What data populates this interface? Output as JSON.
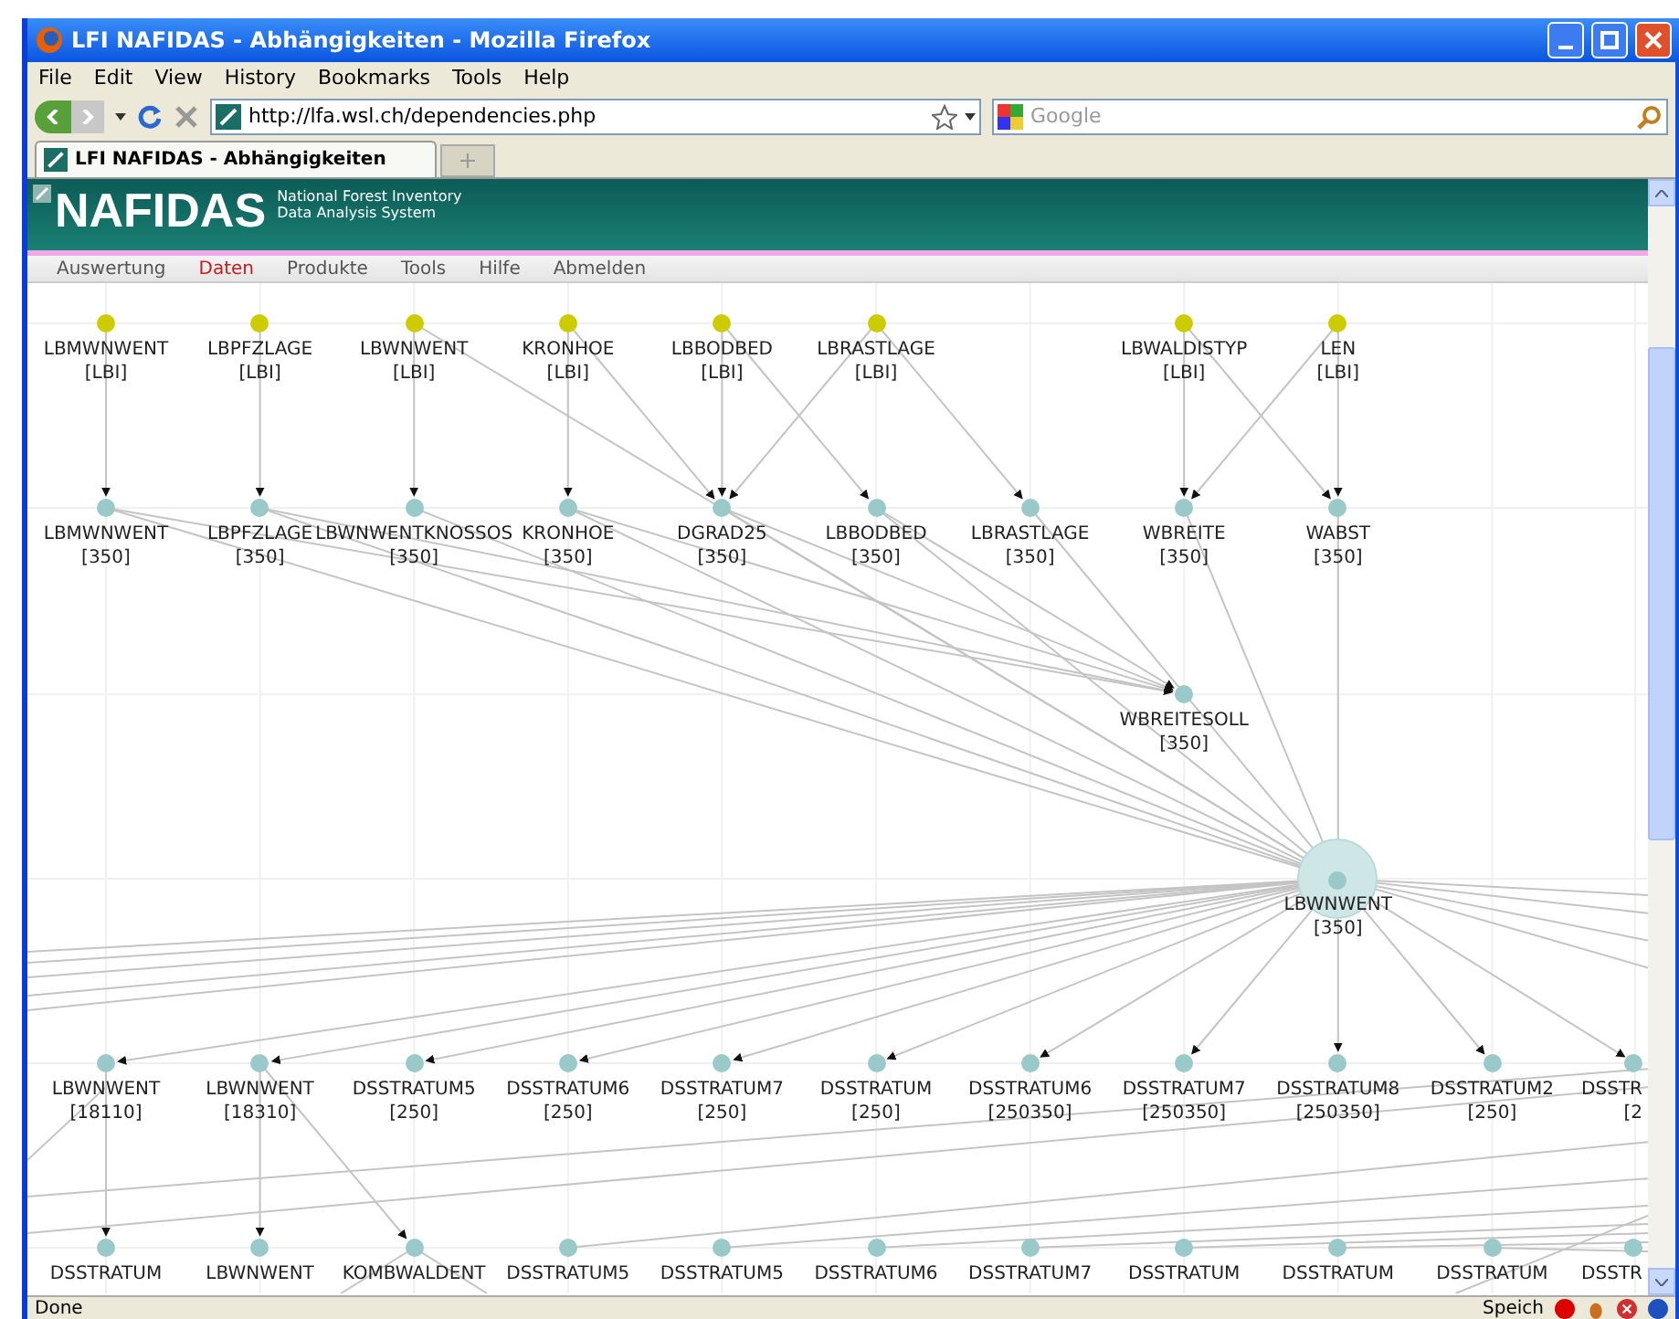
{
  "window": {
    "title": "LFI NAFIDAS - Abhängigkeiten - Mozilla Firefox"
  },
  "menu_bar": [
    "File",
    "Edit",
    "View",
    "History",
    "Bookmarks",
    "Tools",
    "Help"
  ],
  "toolbar": {
    "url": "http://lfa.wsl.ch/dependencies.php",
    "search_placeholder": "Google"
  },
  "tabs": [
    {
      "label": "LFI NAFIDAS - Abhängigkeiten",
      "selected": true
    }
  ],
  "site": {
    "logo": "NAFIDAS",
    "subtitle": [
      "National Forest Inventory",
      "Data Analysis System"
    ],
    "nav": [
      {
        "label": "Auswertung",
        "selected": false
      },
      {
        "label": "Daten",
        "selected": true
      },
      {
        "label": "Produkte",
        "selected": false
      },
      {
        "label": "Tools",
        "selected": false
      },
      {
        "label": "Hilfe",
        "selected": false
      },
      {
        "label": "Abmelden",
        "selected": false
      }
    ]
  },
  "graph": {
    "rows": [
      [
        {
          "name": "LBMWNWENT",
          "tag": "[LBI]",
          "kind": "input"
        },
        {
          "name": "LBPFZLAGE",
          "tag": "[LBI]",
          "kind": "input"
        },
        {
          "name": "LBWNWENT",
          "tag": "[LBI]",
          "kind": "input"
        },
        {
          "name": "KRONHOE",
          "tag": "[LBI]",
          "kind": "input"
        },
        {
          "name": "LBBODBED",
          "tag": "[LBI]",
          "kind": "input"
        },
        {
          "name": "LBRASTLAGE",
          "tag": "[LBI]",
          "kind": "input"
        },
        "",
        {
          "name": "LBWALDISTYP",
          "tag": "[LBI]",
          "kind": "input"
        },
        {
          "name": "LEN",
          "tag": "[LBI]",
          "kind": "input"
        }
      ],
      [
        {
          "name": "LBMWNWENT",
          "tag": "[350]",
          "kind": "derived"
        },
        {
          "name": "LBPFZLAGE",
          "tag": "[350]",
          "kind": "derived"
        },
        {
          "name": "LBWNWENTKNOSSOS",
          "tag": "[350]",
          "kind": "derived"
        },
        {
          "name": "KRONHOE",
          "tag": "[350]",
          "kind": "derived"
        },
        {
          "name": "DGRAD25",
          "tag": "[350]",
          "kind": "derived"
        },
        {
          "name": "LBBODBED",
          "tag": "[350]",
          "kind": "derived"
        },
        {
          "name": "LBRASTLAGE",
          "tag": "[350]",
          "kind": "derived"
        },
        {
          "name": "WBREITE",
          "tag": "[350]",
          "kind": "derived"
        },
        {
          "name": "WABST",
          "tag": "[350]",
          "kind": "derived"
        }
      ],
      [
        "",
        "",
        "",
        "",
        "",
        "",
        "",
        {
          "name": "WBREITESOLL",
          "tag": "[350]",
          "kind": "derived"
        }
      ],
      [
        "",
        "",
        "",
        "",
        "",
        "",
        "",
        "",
        {
          "name": "LBWNWENT",
          "tag": "[350]",
          "kind": "focus"
        }
      ],
      [
        {
          "name": "LBWNWENT",
          "tag": "[18110]",
          "kind": "derived"
        },
        {
          "name": "LBWNWENT",
          "tag": "[18310]",
          "kind": "derived"
        },
        {
          "name": "DSSTRATUM5",
          "tag": "[250]",
          "kind": "derived"
        },
        {
          "name": "DSSTRATUM6",
          "tag": "[250]",
          "kind": "derived"
        },
        {
          "name": "DSSTRATUM7",
          "tag": "[250]",
          "kind": "derived"
        },
        {
          "name": "DSSTRATUM",
          "tag": "[250]",
          "kind": "derived"
        },
        {
          "name": "DSSTRATUM6",
          "tag": "[250350]",
          "kind": "derived"
        },
        {
          "name": "DSSTRATUM7",
          "tag": "[250350]",
          "kind": "derived"
        },
        {
          "name": "DSSTRATUM8",
          "tag": "[250350]",
          "kind": "derived"
        },
        {
          "name": "DSSTRATUM2",
          "tag": "[250]",
          "kind": "derived"
        },
        {
          "name": "DSSTR",
          "tag": "[2",
          "kind": "derived"
        }
      ],
      [
        {
          "name": "DSSTRATUM",
          "kind": "derived"
        },
        {
          "name": "LBWNWENT",
          "kind": "derived"
        },
        {
          "name": "KOMBWALDENT",
          "kind": "derived"
        },
        {
          "name": "DSSTRATUM5",
          "kind": "derived"
        },
        {
          "name": "DSSTRATUM5",
          "kind": "derived"
        },
        {
          "name": "DSSTRATUM6",
          "kind": "derived"
        },
        {
          "name": "DSSTRATUM7",
          "kind": "derived"
        },
        {
          "name": "DSSTRATUM",
          "kind": "derived"
        },
        {
          "name": "DSSTRATUM",
          "kind": "derived"
        },
        {
          "name": "DSSTRATUM",
          "kind": "derived"
        },
        {
          "name": "DSSTR",
          "kind": "derived"
        }
      ]
    ]
  },
  "status_bar": {
    "text": "Done",
    "indicator": "Speich"
  }
}
